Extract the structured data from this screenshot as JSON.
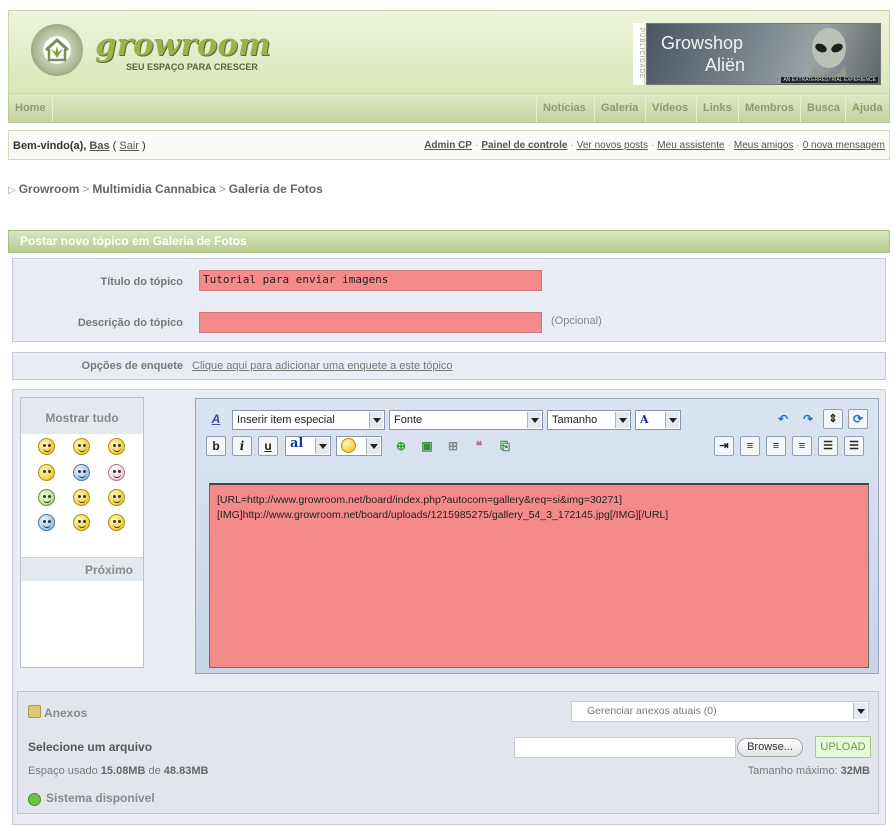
{
  "header": {
    "logo_text": "growroom",
    "logo_tagline": "SEU ESPAÇO PARA CRESCER",
    "ad_label": "PUBLICIDADE",
    "ad_title_line1": "Growshop",
    "ad_title_line2": "Aliën",
    "ad_sub": "AN EXTRATERRESTRIAL EXPERIENCE"
  },
  "nav": {
    "home": "Home",
    "items": [
      "Notícias",
      "Galeria",
      "Vídeos",
      "Links",
      "Membros",
      "Busca",
      "Ajuda"
    ]
  },
  "userbar": {
    "welcome_prefix": "Bem-vindo(a),",
    "username": "Bas",
    "logout": "Sair",
    "links": [
      "Admin CP",
      "Painel de controle",
      "Ver novos posts",
      "Meu assistente",
      "Meus amigos",
      "0 nova mensagem"
    ]
  },
  "breadcrumb": [
    "Growroom",
    "Multimidia Cannabica",
    "Galeria de Fotos"
  ],
  "form": {
    "header": "Postar novo tópico em Galeria de Fotos",
    "title_label": "Título do tópico",
    "title_value": "Tutorial para enviar imagens",
    "description_label": "Descrição do tópico",
    "description_value": "",
    "optional_hint": "(Opcional)",
    "poll_label": "Opções de enquete",
    "poll_link": "Clique aqui para adicionar uma enquete a este tópico"
  },
  "emoticons": {
    "title": "Mostrar tudo",
    "next": "Próximo"
  },
  "editor": {
    "special_item": "Inserir item especial",
    "font": "Fonte",
    "size": "Tamanho",
    "color_letter": "A",
    "bold": "b",
    "italic": "i",
    "underline": "u",
    "font_sample": "al",
    "content_line1": "[URL=http://www.growroom.net/board/index.php?autocom=gallery&req=si&img=30271]",
    "content_line2": "[IMG]http://www.growroom.net/board/uploads/1215985275/gallery_54_3_172145.jpg[/IMG][/URL]"
  },
  "attachments": {
    "title": "Anexos",
    "manage_placeholder": "Gerenciar anexos atuais (0)",
    "select_file": "Selecione um arquivo",
    "browse": "Browse...",
    "upload": "UPLOAD",
    "space_used_label": "Espaço usado",
    "space_used": "15.08MB",
    "space_of": "de",
    "space_total": "48.83MB",
    "max_size_label": "Tamanho máximo:",
    "max_size": "32MB",
    "status": "Sistema disponível"
  }
}
